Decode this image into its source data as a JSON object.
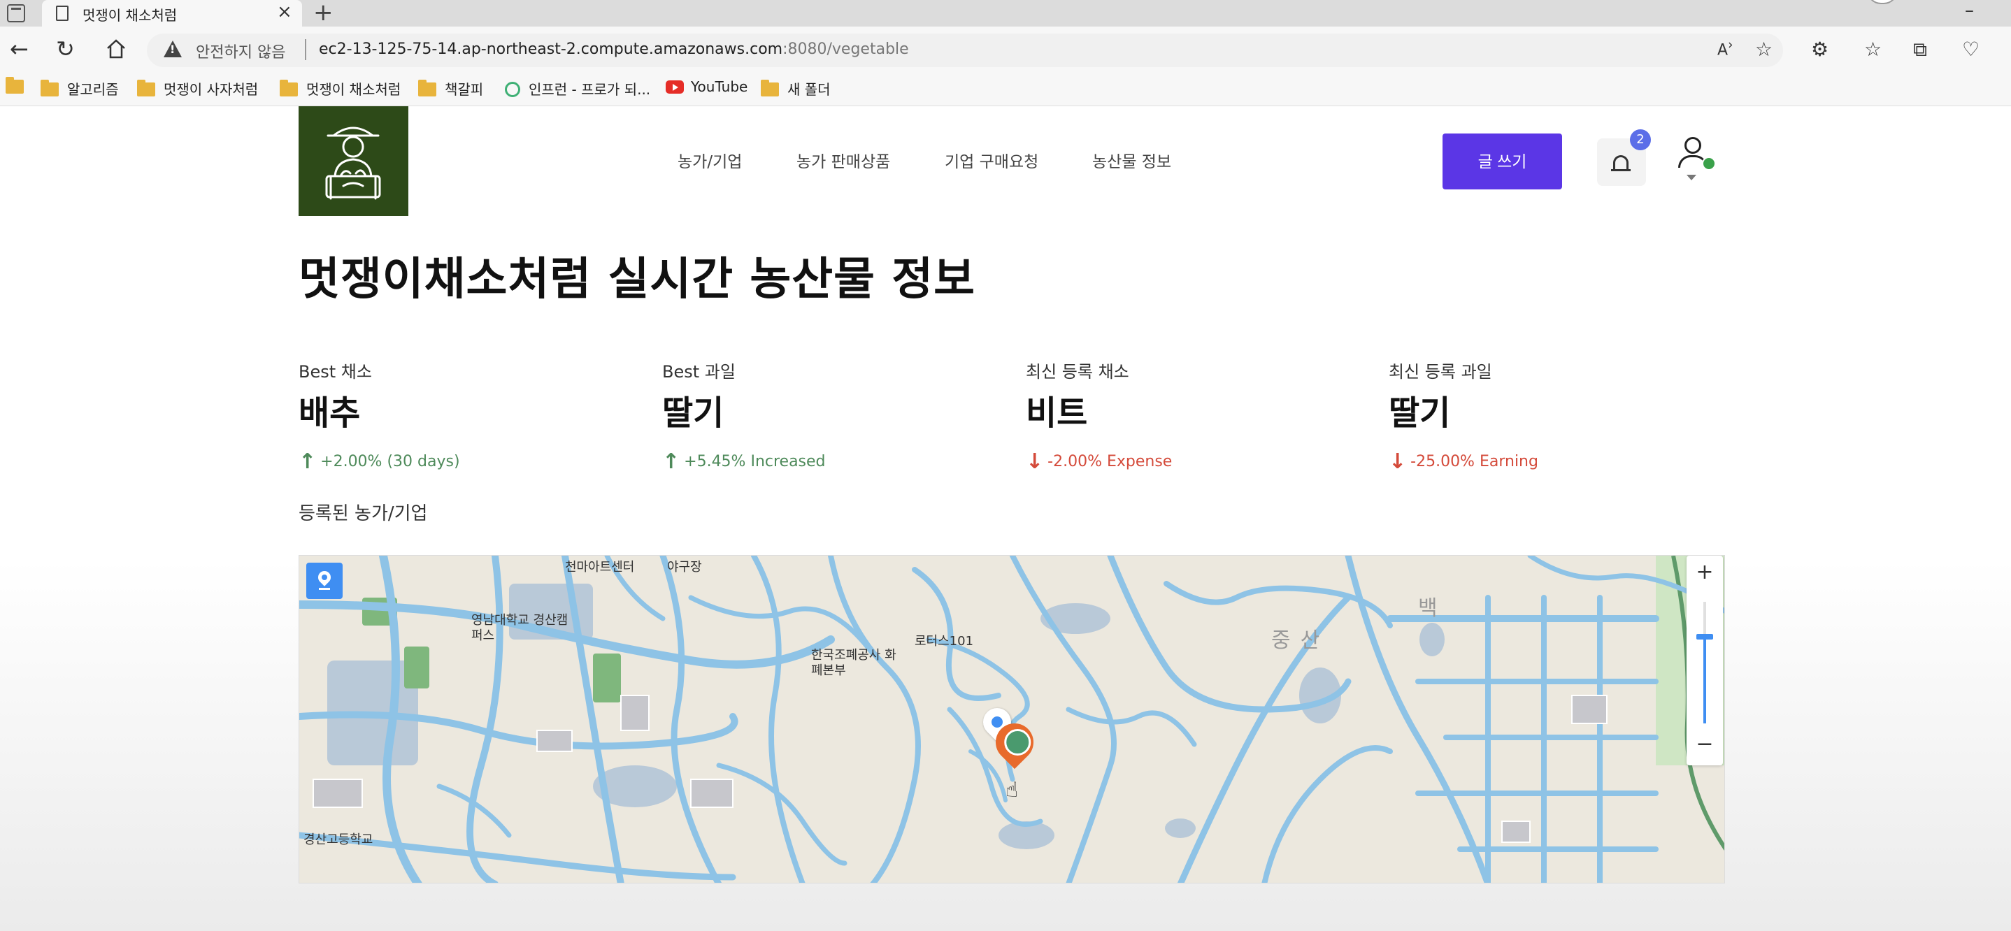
{
  "browser": {
    "tab_title": "멋쟁이 채소처럼",
    "tab_close": "×",
    "new_tab": "+",
    "security_warning": "안전하지 않음",
    "url_host": "ec2-13-125-75-14.ap-northeast-2.compute.amazonaws.com",
    "url_rest": ":8080/vegetable",
    "bookmarks": [
      {
        "label": "알고리즘",
        "icon": "folder-icon"
      },
      {
        "label": "멋쟁이 사자처럼",
        "icon": "folder-icon"
      },
      {
        "label": "멋쟁이 채소처럼",
        "icon": "folder-icon"
      },
      {
        "label": "책갈피",
        "icon": "folder-icon"
      },
      {
        "label": "인프런 - 프로가 되...",
        "icon": "inflearn-icon"
      },
      {
        "label": "YouTube",
        "icon": "youtube-icon"
      },
      {
        "label": "새 폴더",
        "icon": "folder-icon"
      }
    ]
  },
  "header": {
    "nav": [
      "농가/기업",
      "농가 판매상품",
      "기업 구매요청",
      "농산물 정보"
    ],
    "write_button": "글 쓰기",
    "notification_count": "2"
  },
  "main": {
    "title": "멋쟁이채소처럼 실시간 농산물 정보",
    "stats": [
      {
        "label": "Best 채소",
        "value": "배추",
        "arrow": "↑",
        "delta": "+2.00% (30 days)",
        "trend": "up"
      },
      {
        "label": "Best 과일",
        "value": "딸기",
        "arrow": "↑",
        "delta": "+5.45% Increased",
        "trend": "up"
      },
      {
        "label": "최신 등록 채소",
        "value": "비트",
        "arrow": "↓",
        "delta": "-2.00% Expense",
        "trend": "down"
      },
      {
        "label": "최신 등록 과일",
        "value": "딸기",
        "arrow": "↓",
        "delta": "-25.00% Earning",
        "trend": "down"
      }
    ],
    "section_label": "등록된 농가/기업"
  },
  "map": {
    "zoom_in": "+",
    "zoom_out": "−",
    "labels": [
      "야구장",
      "영남대학교 경산캠퍼스",
      "한국조폐공사 화폐본부",
      "로터스101",
      "경산고등학교",
      "백",
      "중산",
      "천마아트센터"
    ],
    "road_color": "#8ec3e6",
    "marker_color": "#e86a2b"
  },
  "colors": {
    "accent": "#5b36e6",
    "up": "#4e8a5a",
    "down": "#d44a3a",
    "logo_bg": "#2d4a18"
  }
}
